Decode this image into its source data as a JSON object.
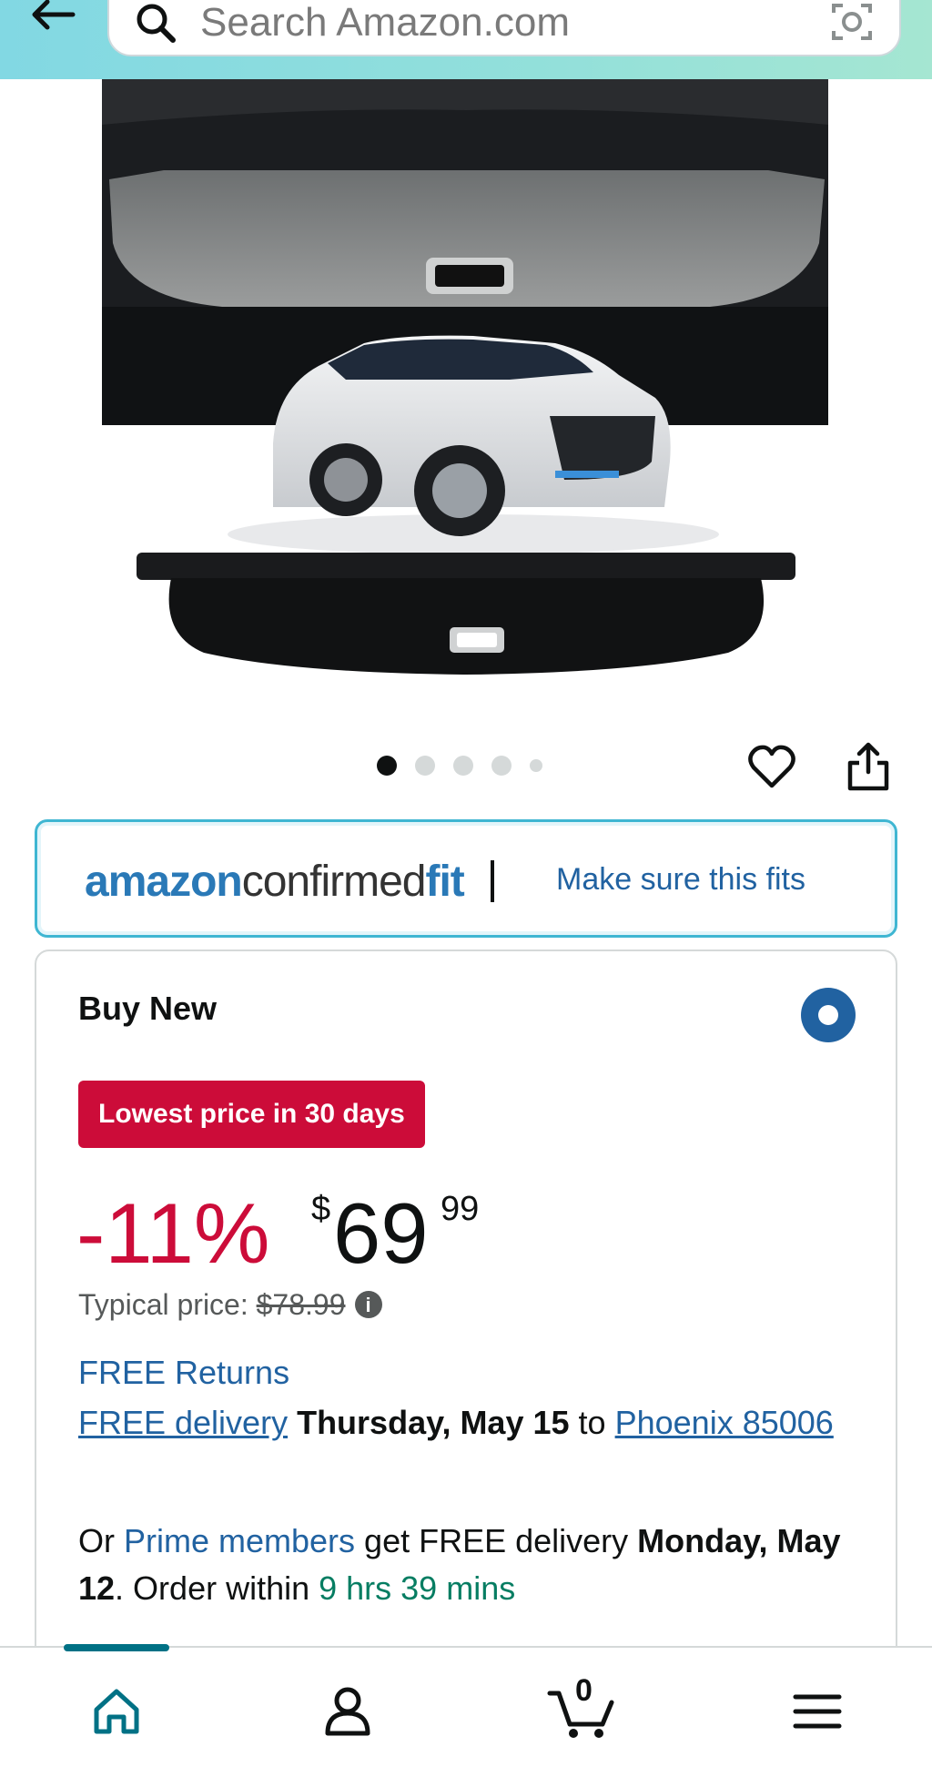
{
  "header": {
    "search_placeholder": "Search Amazon.com"
  },
  "icons": {
    "back": "arrow-left",
    "search": "magnifier",
    "camera": "camera-lens",
    "wishlist": "heart-outline",
    "share": "share-upload",
    "info": "info-circle",
    "home": "home",
    "account": "person",
    "cart": "cart",
    "menu": "hamburger"
  },
  "carousel": {
    "total_images": 5,
    "active_index": 0
  },
  "fit": {
    "logo_part1": "amazon",
    "logo_part2": "confirmed",
    "logo_part3": "fit",
    "link_label": "Make sure this fits"
  },
  "buy_box": {
    "title": "Buy New",
    "deal_badge": "Lowest price in 30 days",
    "discount": "-11%",
    "currency": "$",
    "price_whole": "69",
    "price_fraction": "99",
    "typical_label": "Typical price: ",
    "typical_price": "$78.99",
    "free_returns": "FREE Returns",
    "delivery_link": "FREE delivery",
    "delivery_date": "Thursday, May 15",
    "delivery_to": "to",
    "delivery_location": "Phoenix 85006",
    "prime_prefix": "Or ",
    "prime_link": "Prime members",
    "prime_middle": " get FREE delivery ",
    "prime_date": "Monday, May 12",
    "order_within": ". Order within ",
    "countdown": "9 hrs 39 mins"
  },
  "bottom_nav": {
    "cart_count": "0",
    "active_tab": "home"
  },
  "colors": {
    "header_gradient_start": "#82d8e3",
    "header_gradient_end": "#a5e6d2",
    "link_blue": "#2162a1",
    "deal_red": "#cc0c39",
    "countdown_green": "#067d62",
    "nav_active": "#007185"
  }
}
